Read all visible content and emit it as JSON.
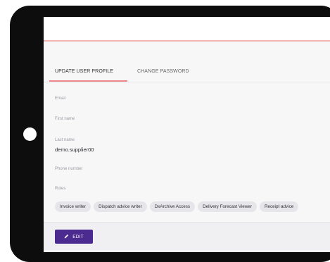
{
  "tabs": [
    {
      "label": "UPDATE USER PROFILE",
      "active": true
    },
    {
      "label": "CHANGE PASSWORD",
      "active": false
    }
  ],
  "fields": {
    "email": {
      "label": "Email",
      "value": ""
    },
    "first_name": {
      "label": "First name",
      "value": ""
    },
    "last_name": {
      "label": "Last name",
      "value": "demo.supplier00"
    },
    "phone": {
      "label": "Phone number",
      "value": ""
    },
    "roles": {
      "label": "Roles"
    }
  },
  "roles": [
    "Invoice writer",
    "Dispatch advice writer",
    "DxArchive Access",
    "Delivery Forecast Viewer",
    "Receipt advice"
  ],
  "actions": {
    "edit_label": "EDIT",
    "edit_icon": "pencil-icon"
  },
  "colors": {
    "accent": "#f08a8a",
    "primary": "#4b2b8f"
  }
}
